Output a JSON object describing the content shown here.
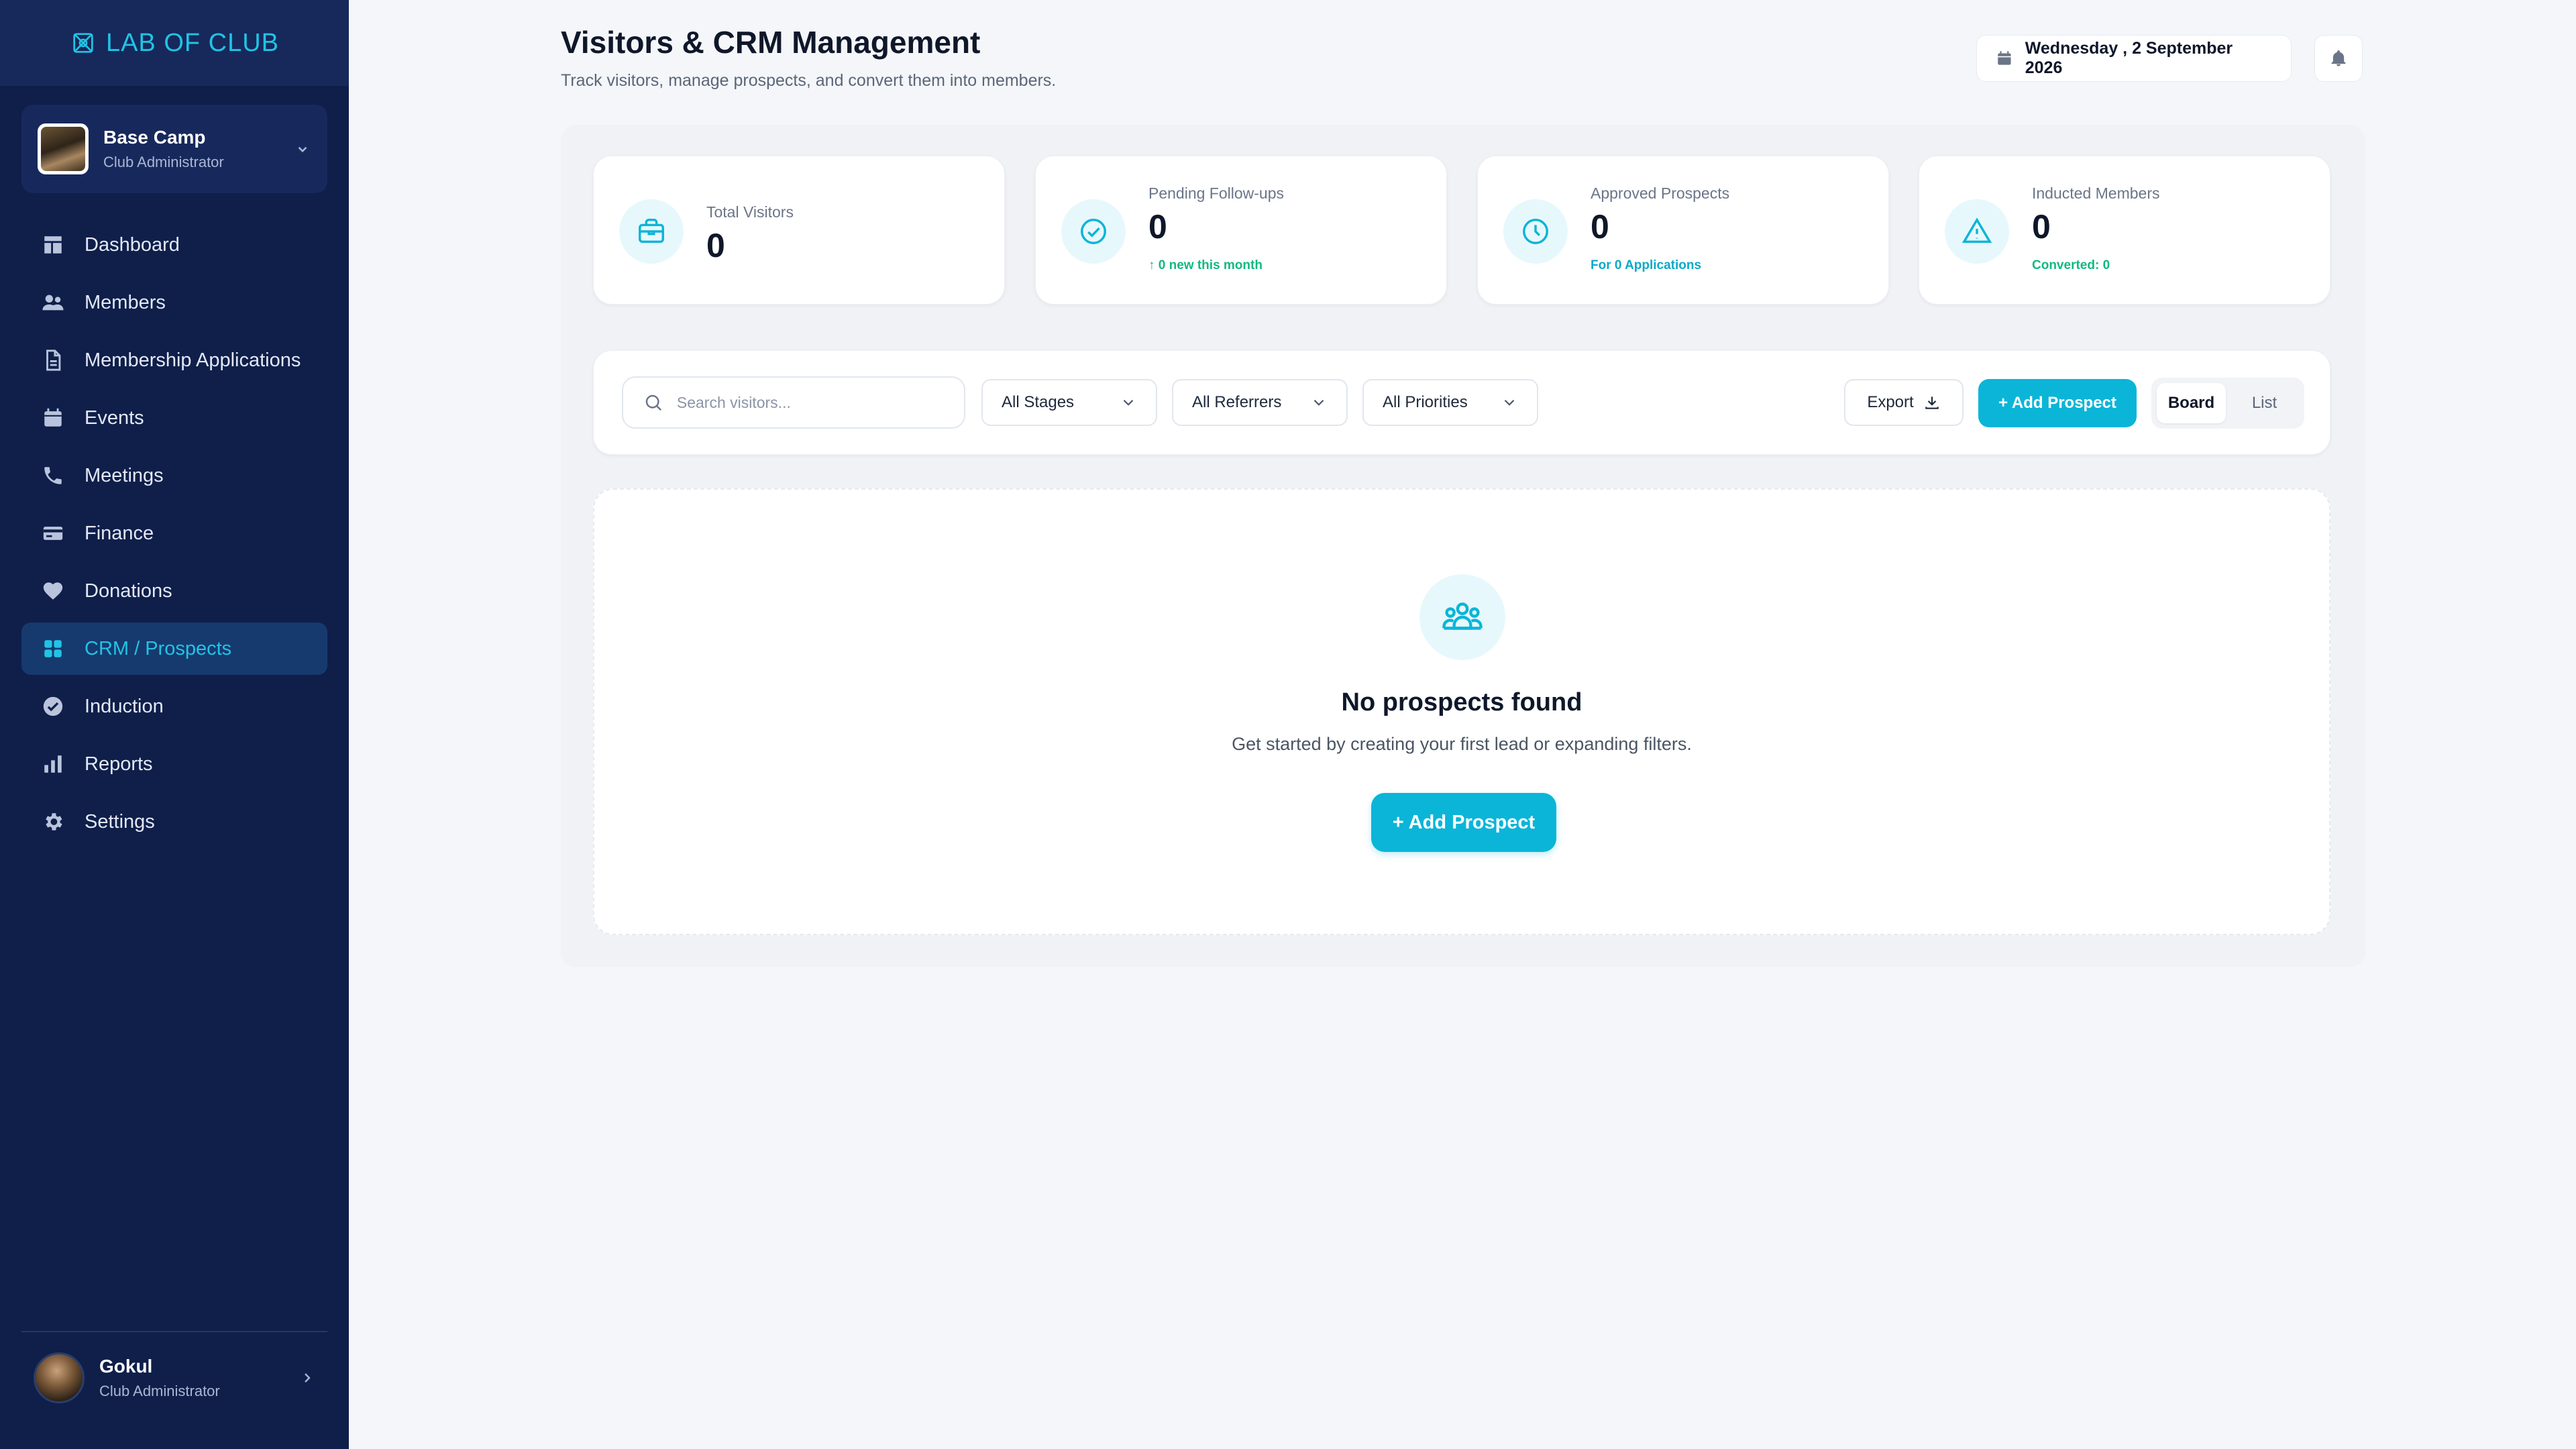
{
  "brand": {
    "logo_text": "LAB OF CLUB",
    "accent_color": "#22c3e6"
  },
  "org": {
    "name": "Base Camp",
    "role": "Club Administrator"
  },
  "nav": {
    "items": [
      {
        "label": "Dashboard",
        "icon": "dashboard-icon",
        "active": false
      },
      {
        "label": "Members",
        "icon": "members-icon",
        "active": false
      },
      {
        "label": "Membership Applications",
        "icon": "document-icon",
        "active": false
      },
      {
        "label": "Events",
        "icon": "calendar-icon",
        "active": false
      },
      {
        "label": "Meetings",
        "icon": "phone-icon",
        "active": false
      },
      {
        "label": "Finance",
        "icon": "credit-card-icon",
        "active": false
      },
      {
        "label": "Donations",
        "icon": "heart-icon",
        "active": false
      },
      {
        "label": "CRM / Prospects",
        "icon": "grid-icon",
        "active": true
      },
      {
        "label": "Induction",
        "icon": "check-circle-icon",
        "active": false
      },
      {
        "label": "Reports",
        "icon": "bar-chart-icon",
        "active": false
      },
      {
        "label": "Settings",
        "icon": "gear-icon",
        "active": false
      }
    ]
  },
  "user": {
    "name": "Gokul",
    "role": "Club Administrator"
  },
  "header": {
    "title": "Visitors & CRM Management",
    "subtitle": "Track visitors, manage prospects, and convert them into members.",
    "date": "Wednesday , 2 September 2026"
  },
  "stats": [
    {
      "label": "Total Visitors",
      "value": "0",
      "sub": "",
      "icon": "briefcase-icon"
    },
    {
      "label": "Pending Follow-ups",
      "value": "0",
      "sub": "↑ 0 new this month",
      "icon": "check-circle-icon"
    },
    {
      "label": "Approved Prospects",
      "value": "0",
      "sub": "For 0 Applications",
      "icon": "clock-icon"
    },
    {
      "label": "Inducted Members",
      "value": "0",
      "sub": "Converted: 0",
      "icon": "alert-triangle-icon"
    }
  ],
  "toolbar": {
    "search_placeholder": "Search visitors...",
    "filters": [
      "All Stages",
      "All Referrers",
      "All Priorities"
    ],
    "export_label": "Export",
    "add_label": "+ Add Prospect",
    "views": [
      "Board",
      "List"
    ],
    "active_view": "Board"
  },
  "empty_state": {
    "title": "No prospects found",
    "description": "Get started by creating your first lead or expanding filters.",
    "button_label": "+ Add Prospect",
    "icon": "users-group-icon"
  }
}
